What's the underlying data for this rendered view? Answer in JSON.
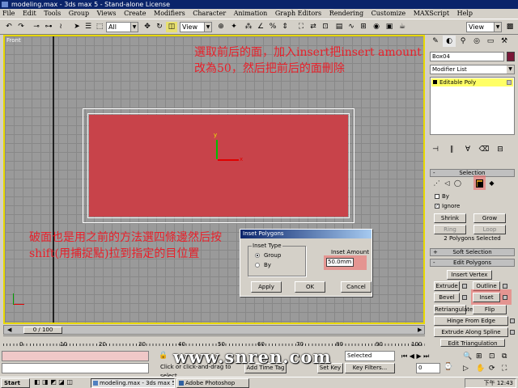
{
  "window": {
    "title": "modeling.max - 3ds max 5 - Stand-alone License"
  },
  "menu": [
    "File",
    "Edit",
    "Tools",
    "Group",
    "Views",
    "Create",
    "Modifiers",
    "Character",
    "Animation",
    "Graph Editors",
    "Rendering",
    "Customize",
    "MAXScript",
    "Help"
  ],
  "toolbar": {
    "filter_value": "All",
    "refcoord_value": "View",
    "named_sel_value": "View"
  },
  "viewport": {
    "label": "Front",
    "gizmo_y": "y",
    "gizmo_x": "x"
  },
  "annotations": {
    "top": "選取前后的面，加入insert把insert amount改為50，然后把前后的面刪除",
    "left": "破面也是用之前的方法選四條邊然后按shift(用捕捉點)拉到指定的目位置"
  },
  "dialog": {
    "title": "Inset Polygons",
    "group_label": "Inset Type",
    "radio_group": "Group",
    "radio_by": "By",
    "amount_label": "Inset Amount",
    "amount_value": "50.0mm",
    "apply": "Apply",
    "ok": "OK",
    "cancel": "Cancel"
  },
  "command_panel": {
    "object_name": "Box04",
    "object_color": "#7a1838",
    "modifier_list": "Modifier List",
    "stack_item": "Editable Poly",
    "selection": {
      "title": "Selection",
      "by_label": "By",
      "ignore_label": "Ignore",
      "shrink": "Shrink",
      "grow": "Grow",
      "ring": "Ring",
      "loop": "Loop",
      "status": "2 Polygons Selected"
    },
    "soft_selection": "Soft Selection",
    "edit_polygons": {
      "title": "Edit Polygons",
      "insert_vertex": "Insert Vertex",
      "extrude": "Extrude",
      "outline": "Outline",
      "bevel": "Bevel",
      "inset": "Inset",
      "retriangulate": "Retriangulate",
      "flip": "Flip",
      "hinge_from_edge": "Hinge From Edge",
      "extrude_along_spline": "Extrude Along Spline",
      "edit_triangulation": "Edit Triangulation"
    }
  },
  "timeline": {
    "slider": "0 / 100",
    "ticks": [
      "0",
      "10",
      "20",
      "30",
      "40",
      "50",
      "60",
      "70",
      "80",
      "90",
      "100"
    ]
  },
  "status": {
    "prompt": "Click or click-and-drag to select",
    "add_time_tag": "Add Time Tag",
    "set_key": "Set Key",
    "key_filters": "Key Filters...",
    "key_mode": "Selected",
    "frame": "0"
  },
  "watermark": "www.snren.com",
  "taskbar": {
    "start": "Start",
    "tasks": [
      "modeling.max - 3ds max 5...",
      "Adobe Photoshop"
    ],
    "clock": "下午 12:43"
  },
  "colors": {
    "face": "#c8434a",
    "viewport_border": "#e8d800",
    "annotation": "#e8202a",
    "highlight": "#f06464"
  }
}
